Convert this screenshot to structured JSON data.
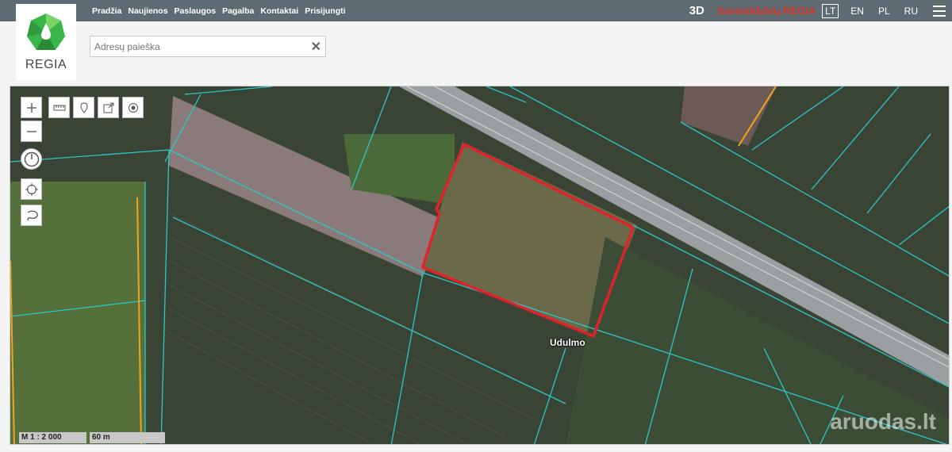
{
  "header": {
    "nav": [
      "Pradžia",
      "Naujienos",
      "Paslaugos",
      "Pagalba",
      "Kontaktai",
      "Prisijungti"
    ],
    "btn_3d": "3D",
    "brand": "Savivaldybių REGIA",
    "languages": [
      "LT",
      "EN",
      "PL",
      "RU"
    ],
    "active_language": "LT"
  },
  "logo": {
    "text": "REGIA"
  },
  "search": {
    "placeholder": "Adresų paieška",
    "clear": "✕"
  },
  "map": {
    "scale_ratio": "M 1 : 2 000",
    "scale_distance": "60 m",
    "plot_label": "Udulmo",
    "watermark": "aruodas.lt"
  },
  "colors": {
    "topbar": "#5f6b73",
    "brand": "#d9372e",
    "parcel_lines": "#2ec7c9",
    "selected_plot": "#e0222a",
    "boundary": "#f2a41c"
  }
}
